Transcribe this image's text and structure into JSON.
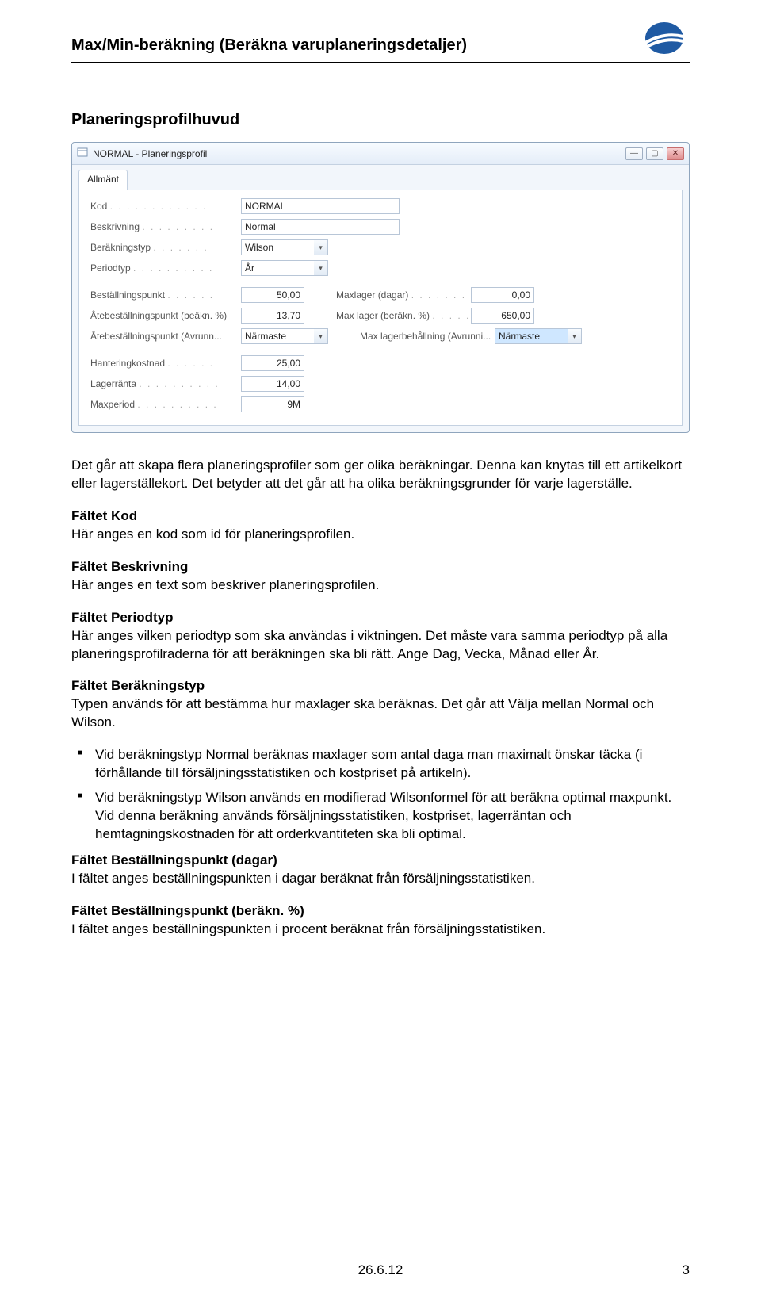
{
  "doc_title": "Max/Min-beräkning (Beräkna varuplaneringsdetaljer)",
  "section_heading": "Planeringsprofilhuvud",
  "window": {
    "title": "NORMAL - Planeringsprofil",
    "tab": "Allmänt",
    "fields": {
      "kod": {
        "label": "Kod",
        "value": "NORMAL"
      },
      "beskrivning": {
        "label": "Beskrivning",
        "value": "Normal"
      },
      "berakningstyp": {
        "label": "Beräkningstyp",
        "value": "Wilson"
      },
      "periodtyp": {
        "label": "Periodtyp",
        "value": "År"
      },
      "bestallningspunkt": {
        "label": "Beställningspunkt",
        "value": "50,00"
      },
      "atbestallning_pct": {
        "label": "Åtebeställningspunkt (beäkn. %)",
        "value": "13,70"
      },
      "atbestallning_avrun": {
        "label": "Åtebeställningspunkt (Avrunn...",
        "value": "Närmaste"
      },
      "maxlager_dagar": {
        "label": "Maxlager (dagar)",
        "value": "0,00"
      },
      "maxlager_berakn": {
        "label": "Max lager (beräkn. %)",
        "value": "650,00"
      },
      "maxlager_avrun": {
        "label": "Max lagerbehållning (Avrunni...",
        "value": "Närmaste"
      },
      "hanteringskostnad": {
        "label": "Hanteringkostnad",
        "value": "25,00"
      },
      "lagerranta": {
        "label": "Lagerränta",
        "value": "14,00"
      },
      "maxperiod": {
        "label": "Maxperiod",
        "value": "9M"
      }
    }
  },
  "body": {
    "intro": "Det går att skapa flera planeringsprofiler som ger olika beräkningar. Denna kan knytas till ett artikelkort eller lagerställekort. Det betyder att det går att ha olika beräkningsgrunder för varje lagerställe.",
    "kod_h": "Fältet Kod",
    "kod_p": "Här anges en kod som id för planeringsprofilen.",
    "beskr_h": "Fältet Beskrivning",
    "beskr_p": "Här anges en text som beskriver planeringsprofilen.",
    "period_h": "Fältet Periodtyp",
    "period_p": "Här anges vilken periodtyp som ska användas i viktningen. Det måste vara samma periodtyp på alla planeringsprofilraderna för att beräkningen ska bli rätt. Ange Dag, Vecka, Månad eller År.",
    "berak_h": "Fältet Beräkningstyp",
    "berak_p": "Typen används för att bestämma hur maxlager ska beräknas. Det går att Välja mellan Normal och Wilson.",
    "bullet1": "Vid beräkningstyp Normal beräknas maxlager som antal daga man maximalt önskar täcka (i förhållande till försäljningsstatistiken och kostpriset på artikeln).",
    "bullet2": "Vid beräkningstyp Wilson används en modifierad Wilsonformel för att beräkna optimal maxpunkt. Vid denna beräkning används försäljningsstatistiken, kostpriset, lagerräntan och hemtagningskostnaden för att orderkvantiteten ska bli optimal.",
    "bestall_dag_h": "Fältet Beställningspunkt (dagar)",
    "bestall_dag_p": "I fältet anges beställningspunkten i dagar beräknat från försäljningsstatistiken.",
    "bestall_pct_h": "Fältet Beställningspunkt (beräkn. %)",
    "bestall_pct_p": "I fältet anges beställningspunkten i procent beräknat från försäljningsstatistiken."
  },
  "footer_date": "26.6.12",
  "page_number": "3"
}
